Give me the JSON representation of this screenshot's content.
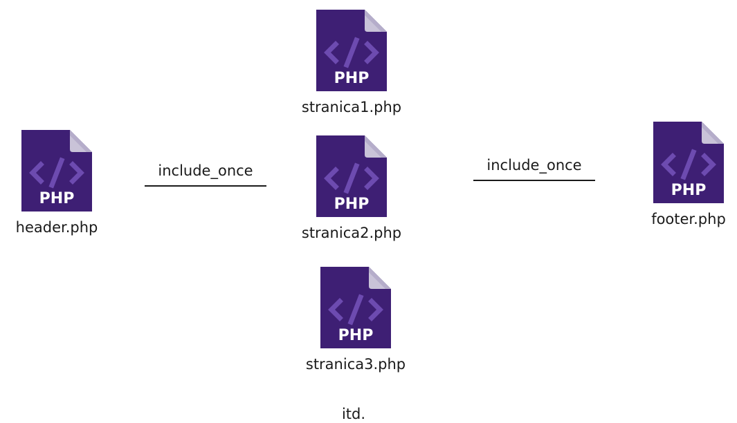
{
  "colors": {
    "file_body": "#3e1f74",
    "file_fold": "#c9c3d8",
    "code_glyph": "#6d4bb0",
    "badge_text": "#ffffff",
    "connector": "#1a1a1a"
  },
  "icon": {
    "name": "php-file-icon",
    "badge": "PHP"
  },
  "nodes": {
    "stranica1": {
      "label": "stranica1.php"
    },
    "stranica2": {
      "label": "stranica2.php"
    },
    "stranica3": {
      "label": "stranica3.php"
    },
    "header": {
      "label": "header.php"
    },
    "footer": {
      "label": "footer.php"
    }
  },
  "edges": {
    "left": {
      "label": "include_once"
    },
    "right": {
      "label": "include_once"
    }
  },
  "more": {
    "label": "itd."
  }
}
